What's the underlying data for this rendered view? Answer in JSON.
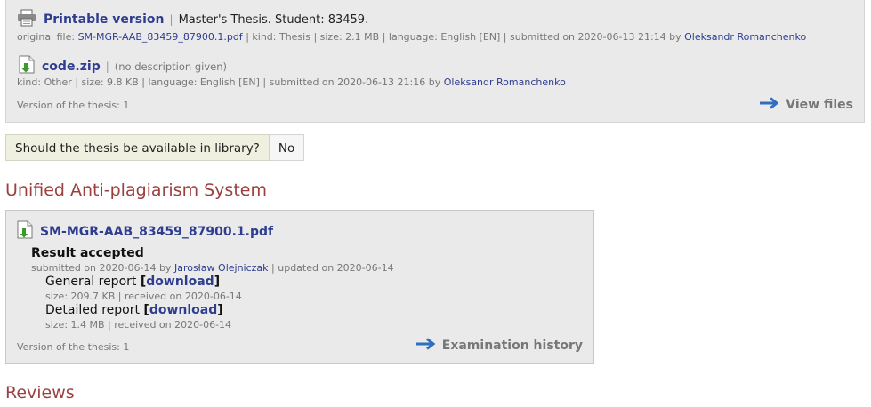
{
  "files": {
    "printable": {
      "title": "Printable version",
      "description": "Master's Thesis. Student: 83459.",
      "meta_prefix": "original file:",
      "original_file": "SM-MGR-AAB_83459_87900.1.pdf",
      "meta_mid": "| kind: Thesis | size: 2.1 MB | language: English [EN] | submitted on 2020-06-13 21:14 by",
      "author": "Oleksandr Romanchenko"
    },
    "zip": {
      "title": "code.zip",
      "description": "(no description given)",
      "meta_mid": "kind: Other | size: 9.8 KB | language: English [EN] | submitted on 2020-06-13 21:16 by",
      "author": "Oleksandr Romanchenko"
    },
    "version": "Version of the thesis: 1",
    "view_files": "View files",
    "separator": "|"
  },
  "library_question": {
    "label": "Should the thesis be available in library?",
    "value": "No"
  },
  "antiplagiarism": {
    "section_title": "Unified Anti-plagiarism System",
    "file": "SM-MGR-AAB_83459_87900.1.pdf",
    "result": "Result accepted",
    "submitted_prefix": "submitted on 2020-06-14 by",
    "submitted_by": "Jarosław Olejniczak",
    "updated": "| updated on 2020-06-14",
    "general_report": {
      "label": "General report",
      "link": "download",
      "meta": "size: 209.7 KB | received on 2020-06-14"
    },
    "detailed_report": {
      "label": "Detailed report",
      "link": "download",
      "meta": "size: 1.4 MB | received on 2020-06-14"
    },
    "version": "Version of the thesis: 1",
    "history": "Examination history",
    "bracket_open": "[",
    "bracket_close": "]"
  },
  "reviews": {
    "section_title": "Reviews"
  },
  "colors": {
    "link": "#2e3d8f",
    "section_title": "#9b3f3f",
    "arrow": "#2f6fc0",
    "panel_bg": "#eaeaea"
  }
}
